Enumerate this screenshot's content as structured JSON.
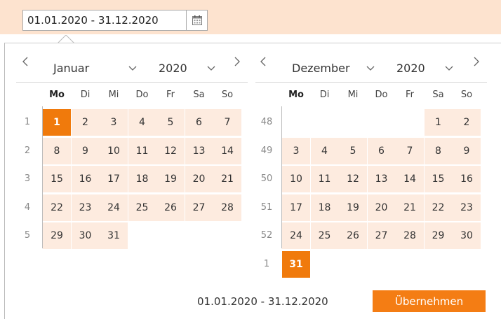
{
  "input": {
    "value": "01.01.2020 - 31.12.2020"
  },
  "calendar_icon": "calendar-icon",
  "weekday_labels": [
    "Mo",
    "Di",
    "Mi",
    "Do",
    "Fr",
    "Sa",
    "So"
  ],
  "left_calendar": {
    "month": "Januar",
    "year": "2020",
    "rows": [
      {
        "week": "1",
        "days": [
          "1",
          "2",
          "3",
          "4",
          "5",
          "6",
          "7"
        ]
      },
      {
        "week": "2",
        "days": [
          "8",
          "9",
          "10",
          "11",
          "12",
          "13",
          "14"
        ]
      },
      {
        "week": "3",
        "days": [
          "15",
          "16",
          "17",
          "18",
          "19",
          "20",
          "21"
        ]
      },
      {
        "week": "4",
        "days": [
          "22",
          "23",
          "24",
          "25",
          "26",
          "27",
          "28"
        ]
      },
      {
        "week": "5",
        "days": [
          "29",
          "30",
          "31",
          "",
          "",
          "",
          ""
        ]
      }
    ],
    "selected_day": "1"
  },
  "right_calendar": {
    "month": "Dezember",
    "year": "2020",
    "rows": [
      {
        "week": "48",
        "days": [
          "",
          "",
          "",
          "",
          "",
          "1",
          "2"
        ]
      },
      {
        "week": "49",
        "days": [
          "3",
          "4",
          "5",
          "6",
          "7",
          "8",
          "9"
        ]
      },
      {
        "week": "50",
        "days": [
          "10",
          "11",
          "12",
          "13",
          "14",
          "15",
          "16"
        ]
      },
      {
        "week": "51",
        "days": [
          "17",
          "18",
          "19",
          "20",
          "21",
          "22",
          "23"
        ]
      },
      {
        "week": "52",
        "days": [
          "24",
          "25",
          "26",
          "27",
          "28",
          "29",
          "30"
        ]
      },
      {
        "week": "1",
        "days": [
          "31",
          "",
          "",
          "",
          "",
          "",
          ""
        ]
      }
    ],
    "selected_day": "31"
  },
  "footer": {
    "range_text": "01.01.2020 - 31.12.2020",
    "apply_label": "Übernehmen"
  },
  "colors": {
    "accent": "#f47d14",
    "selected_day": "#f07a0c",
    "day_background": "#fdebdf",
    "topbar_background": "#fde3cf"
  }
}
